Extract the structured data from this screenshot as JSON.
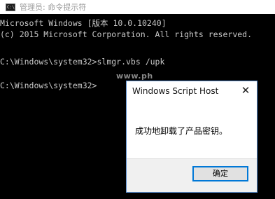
{
  "window": {
    "title": "管理员: 命令提示符",
    "icon": "cmd-icon",
    "icon_glyph": "C:\\"
  },
  "console": {
    "lines": [
      "Microsoft Windows [版本 10.0.10240]",
      "(c) 2015 Microsoft Corporation. All rights reserved.",
      "C:\\Windows\\system32>slmgr.vbs /upk",
      "C:\\Windows\\system32>"
    ],
    "watermark": "www.ph"
  },
  "dialog": {
    "title": "Windows Script Host",
    "close_glyph": "✕",
    "message": "成功地卸载了产品密钥。",
    "ok_label": "确定"
  },
  "colors": {
    "console_background": "#000000",
    "console_text": "#c8c8c8",
    "dialog_border": "#5a8fd1",
    "button_focus_border": "#0078d7"
  }
}
